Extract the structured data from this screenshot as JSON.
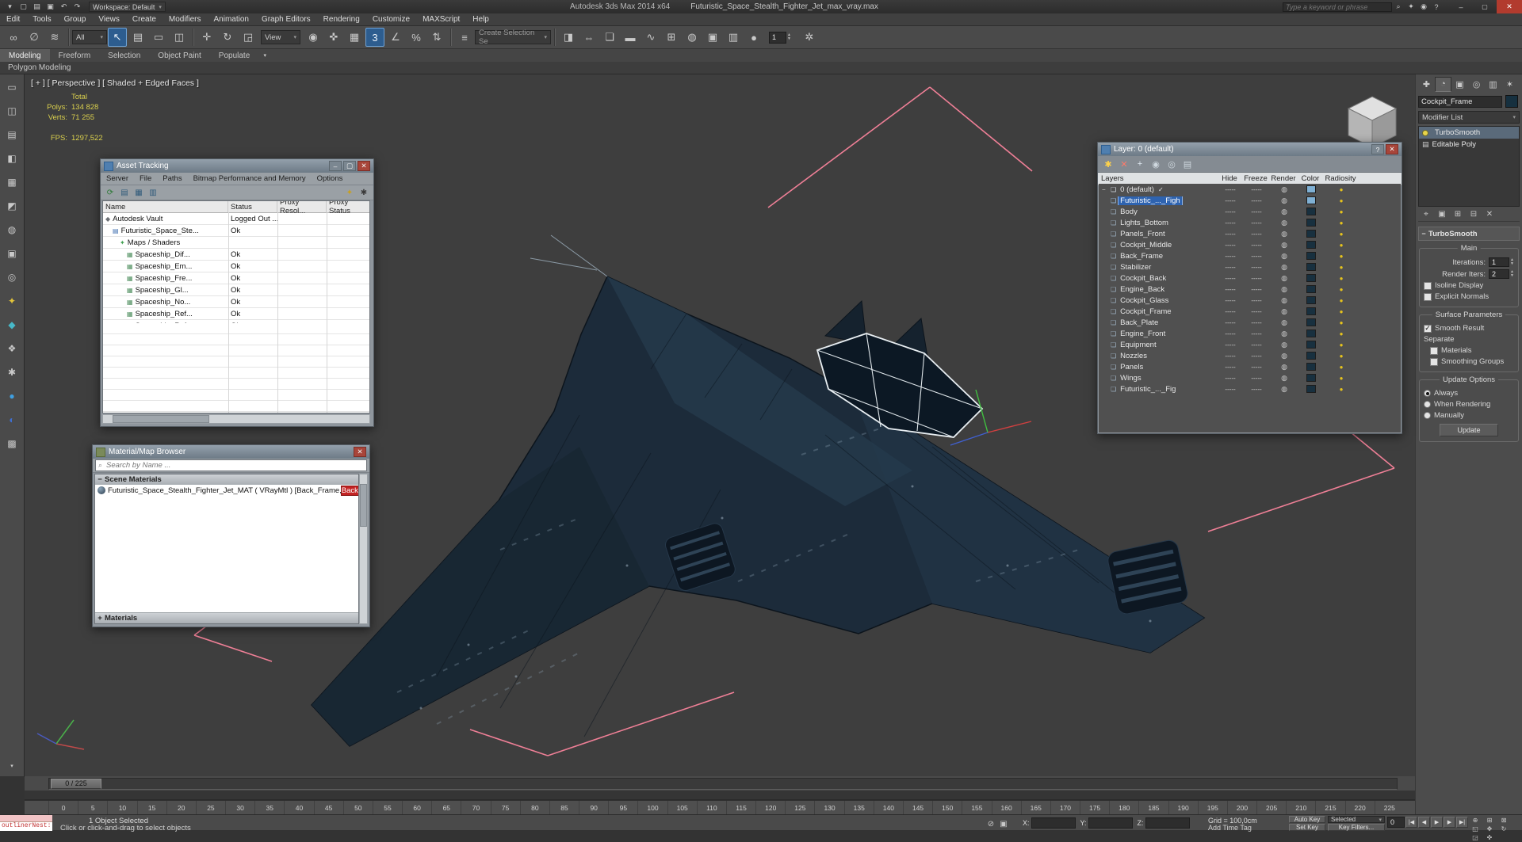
{
  "colors": {
    "accent_blue": "#2d5d8f",
    "selection_pink": "#ee7f96",
    "jet_navy": "#1c2b3a",
    "status_yellow": "#d9cf4d"
  },
  "window_controls": {
    "minimize": "–",
    "maximize": "▢",
    "close": "✕",
    "help": "?"
  },
  "titlebar": {
    "app_title": "Autodesk 3ds Max 2014 x64",
    "doc_title": "Futuristic_Space_Stealth_Fighter_Jet_max_vray.max",
    "workspace": "Workspace: Default",
    "search_placeholder": "Type a keyword or phrase",
    "quick_icons": [
      {
        "name": "app-menu-icon",
        "glyph": "▾"
      },
      {
        "name": "new-scene-icon",
        "glyph": "▢"
      },
      {
        "name": "open-file-icon",
        "glyph": "▤"
      },
      {
        "name": "save-file-icon",
        "glyph": "▣"
      },
      {
        "name": "undo-icon",
        "glyph": "↶"
      },
      {
        "name": "redo-icon",
        "glyph": "↷"
      }
    ],
    "right_icons": [
      {
        "name": "search-go-icon",
        "glyph": "⌕"
      },
      {
        "name": "infocenter-star-icon",
        "glyph": "✦"
      },
      {
        "name": "sign-in-icon",
        "glyph": "◉"
      },
      {
        "name": "help-icon",
        "glyph": "?"
      }
    ]
  },
  "menubar": {
    "items": [
      "Edit",
      "Tools",
      "Group",
      "Views",
      "Create",
      "Modifiers",
      "Animation",
      "Graph Editors",
      "Rendering",
      "Customize",
      "MAXScript",
      "Help"
    ]
  },
  "toolbar": {
    "icons_a": [
      {
        "name": "select-and-link-icon",
        "glyph": "∞"
      },
      {
        "name": "unlink-selection-icon",
        "glyph": "∅"
      },
      {
        "name": "bind-to-space-warp-icon",
        "glyph": "≋"
      }
    ],
    "filter_value": "All",
    "icons_b": [
      {
        "name": "select-object-icon",
        "glyph": "↖",
        "active": true
      },
      {
        "name": "select-by-name-icon",
        "glyph": "▤"
      },
      {
        "name": "rectangular-selection-region-icon",
        "glyph": "▭"
      },
      {
        "name": "window-crossing-icon",
        "glyph": "◫"
      }
    ],
    "icons_c": [
      {
        "name": "select-and-move-icon",
        "glyph": "✛"
      },
      {
        "name": "select-and-rotate-icon",
        "glyph": "↻"
      },
      {
        "name": "select-and-scale-icon",
        "glyph": "◲"
      }
    ],
    "view_value": "View",
    "icons_d": [
      {
        "name": "use-pivot-center-icon",
        "glyph": "◉"
      },
      {
        "name": "select-and-manipulate-icon",
        "glyph": "✜"
      },
      {
        "name": "keyboard-override-icon",
        "glyph": "▦"
      },
      {
        "name": "snaps-toggle-3d-icon",
        "glyph": "3",
        "active": true
      },
      {
        "name": "angle-snap-icon",
        "glyph": "∠"
      },
      {
        "name": "percent-snap-icon",
        "glyph": "%"
      },
      {
        "name": "spinner-snap-icon",
        "glyph": "⇅"
      }
    ],
    "icons_e": [
      {
        "name": "edit-named-selections-icon",
        "glyph": "≡"
      }
    ],
    "named_selection_value": "Create Selection Se",
    "icons_f": [
      {
        "name": "mirror-icon",
        "glyph": "◨"
      },
      {
        "name": "align-icon",
        "glyph": "⇔"
      },
      {
        "name": "layer-explorer-icon",
        "glyph": "❏"
      },
      {
        "name": "ribbon-toggle-icon",
        "glyph": "▬"
      },
      {
        "name": "curve-editor-icon",
        "glyph": "∿"
      },
      {
        "name": "schematic-view-icon",
        "glyph": "⊞"
      },
      {
        "name": "material-editor-icon",
        "glyph": "◍"
      },
      {
        "name": "render-setup-icon",
        "glyph": "▣"
      },
      {
        "name": "rendered-frame-icon",
        "glyph": "▥"
      },
      {
        "name": "render-production-icon",
        "glyph": "●"
      }
    ],
    "spinner_value": "1",
    "icons_g": [
      {
        "name": "render-gear-icon",
        "glyph": "✲"
      }
    ]
  },
  "ribbon": {
    "tabs": [
      {
        "label": "Modeling",
        "active": true
      },
      {
        "label": "Freeform"
      },
      {
        "label": "Selection"
      },
      {
        "label": "Object Paint"
      },
      {
        "label": "Populate"
      }
    ],
    "overflow_glyph": "▾",
    "subtab": "Polygon Modeling"
  },
  "left_toolbar": {
    "icons": [
      {
        "name": "left-tool-1-icon",
        "glyph": "▭"
      },
      {
        "name": "left-tool-2-icon",
        "glyph": "◫"
      },
      {
        "name": "left-tool-3-icon",
        "glyph": "▤"
      },
      {
        "name": "left-tool-4-icon",
        "glyph": "◧"
      },
      {
        "name": "left-tool-5-icon",
        "glyph": "▦"
      },
      {
        "name": "left-tool-6-icon",
        "glyph": "◩"
      },
      {
        "name": "left-tool-7-icon",
        "glyph": "◍"
      },
      {
        "name": "left-tool-8-icon",
        "glyph": "▣"
      },
      {
        "name": "left-tool-9-icon",
        "glyph": "◎"
      },
      {
        "name": "left-tool-10-icon",
        "glyph": "✦",
        "color": "#e3c43a"
      },
      {
        "name": "left-tool-11-icon",
        "glyph": "◆",
        "color": "#47b8c8"
      },
      {
        "name": "left-tool-12-icon",
        "glyph": "❖"
      },
      {
        "name": "left-tool-13-icon",
        "glyph": "✱"
      },
      {
        "name": "left-tool-14-icon",
        "glyph": "●",
        "color": "#3f9fe0"
      },
      {
        "name": "left-tool-15-icon",
        "glyph": "◐",
        "color": "#3f6fd0"
      },
      {
        "name": "left-tool-16-icon",
        "glyph": "▩"
      }
    ],
    "more_glyph": "▾"
  },
  "viewport": {
    "label": "[ + ] [ Perspective ] [ Shaded + Edged Faces ]",
    "stats": {
      "total": "Total",
      "polys_label": "Polys:",
      "polys_value": "134 828",
      "verts_label": "Verts:",
      "verts_value": "71 255",
      "fps_label": "FPS:",
      "fps_value": "1297,522"
    }
  },
  "asset_tracking": {
    "title": "Asset Tracking",
    "menu": [
      "Server",
      "File",
      "Paths",
      "Bitmap Performance and Memory",
      "Options"
    ],
    "toolbar_left": [
      {
        "name": "refresh-status-icon",
        "glyph": "⟳",
        "color": "#2f7a38"
      },
      {
        "name": "report-icon",
        "glyph": "▤",
        "color": "#2f5a7a"
      },
      {
        "name": "table-view-icon",
        "glyph": "▦",
        "color": "#2f5a7a"
      },
      {
        "name": "columns-icon",
        "glyph": "▥",
        "color": "#2f5a7a"
      }
    ],
    "toolbar_right": [
      {
        "name": "vault-login-icon",
        "glyph": "✦",
        "color": "#c8a020"
      },
      {
        "name": "vault-options-icon",
        "glyph": "✱",
        "color": "#3a3a3a"
      }
    ],
    "columns": [
      "Name",
      "Status",
      "Proxy Resol...",
      "Proxy Status"
    ],
    "rows": [
      {
        "name": "Autodesk Vault",
        "status": "Logged Out ...",
        "pad": 3,
        "icon": "◆",
        "icon_color": "#6b6f74"
      },
      {
        "name": "Futuristic_Space_Ste...",
        "status": "Ok",
        "pad": 12,
        "icon": "▤",
        "icon_color": "#3f6fb0"
      },
      {
        "name": "Maps / Shaders",
        "status": "",
        "pad": 21,
        "icon": "✦",
        "icon_color": "#3f9f4f"
      },
      {
        "name": "Spaceship_Dif...",
        "status": "Ok",
        "pad": 30,
        "icon": "▦",
        "icon_color": "#4f8f5f"
      },
      {
        "name": "Spaceship_Em...",
        "status": "Ok",
        "pad": 30,
        "icon": "▦",
        "icon_color": "#4f8f5f"
      },
      {
        "name": "Spaceship_Fre...",
        "status": "Ok",
        "pad": 30,
        "icon": "▦",
        "icon_color": "#4f8f5f"
      },
      {
        "name": "Spaceship_Gl...",
        "status": "Ok",
        "pad": 30,
        "icon": "▦",
        "icon_color": "#4f8f5f"
      },
      {
        "name": "Spaceship_No...",
        "status": "Ok",
        "pad": 30,
        "icon": "▦",
        "icon_color": "#4f8f5f"
      },
      {
        "name": "Spaceship_Ref...",
        "status": "Ok",
        "pad": 30,
        "icon": "▦",
        "icon_color": "#4f8f5f"
      },
      {
        "name": "Spaceship_Ref...",
        "status": "Ok",
        "pad": 30,
        "icon": "▦",
        "icon_color": "#4f8f5f"
      }
    ]
  },
  "material_browser": {
    "title": "Material/Map Browser",
    "search_placeholder": "Search by Name ...",
    "search_icon": "⌕",
    "collapse_glyph": "−",
    "expand_glyph": "+",
    "section": "Scene Materials",
    "item_main": "Futuristic_Space_Stealth_Fighter_Jet_MAT ( VRayMtl ) [Back_Frame, ",
    "item_highlight": "Back_Pl",
    "footer": "Materials"
  },
  "layer_explorer": {
    "title": "Layer: 0 (default)",
    "dash": "-----",
    "render_glyph": "◍",
    "radiosity_glyph": "●",
    "toolbar_icons": [
      {
        "name": "new-layer-icon",
        "glyph": "✱",
        "color": "#ffd34a"
      },
      {
        "name": "delete-layer-icon",
        "glyph": "✕",
        "color": "#ff7a6a"
      },
      {
        "name": "add-to-layer-icon",
        "glyph": "+",
        "color": "#dfe8f0"
      },
      {
        "name": "select-in-layer-icon",
        "glyph": "◉",
        "color": "#cfd8df"
      },
      {
        "name": "set-current-layer-icon",
        "glyph": "◎",
        "color": "#cfd8df"
      },
      {
        "name": "hide-freeze-icon",
        "glyph": "▤",
        "color": "#cfd8df"
      }
    ],
    "columns": [
      "Layers",
      "Hide",
      "Freeze",
      "Render",
      "Color",
      "Radiosity"
    ],
    "rows": [
      {
        "name": "0 (default)",
        "expand": "−",
        "icon": "❏",
        "icon_color": "#d5dde3",
        "check": "✓",
        "color": "#7fb0d4"
      },
      {
        "name": "Futuristic_..._Figh",
        "icon": "❏",
        "icon_color": "#9fc4e8",
        "selected": true,
        "color": "#7fb0d4"
      },
      {
        "name": "Body",
        "icon": "❏",
        "icon_color": "#9fb4c4",
        "color": "#18303f"
      },
      {
        "name": "Lights_Bottom",
        "icon": "❏",
        "icon_color": "#9fb4c4",
        "color": "#18303f"
      },
      {
        "name": "Panels_Front",
        "icon": "❏",
        "icon_color": "#9fb4c4",
        "color": "#18303f"
      },
      {
        "name": "Cockpit_Middle",
        "icon": "❏",
        "icon_color": "#9fb4c4",
        "color": "#18303f"
      },
      {
        "name": "Back_Frame",
        "icon": "❏",
        "icon_color": "#9fb4c4",
        "color": "#18303f"
      },
      {
        "name": "Stabilizer",
        "icon": "❏",
        "icon_color": "#9fb4c4",
        "color": "#18303f"
      },
      {
        "name": "Cockpit_Back",
        "icon": "❏",
        "icon_color": "#9fb4c4",
        "color": "#18303f"
      },
      {
        "name": "Engine_Back",
        "icon": "❏",
        "icon_color": "#9fb4c4",
        "color": "#18303f"
      },
      {
        "name": "Cockpit_Glass",
        "icon": "❏",
        "icon_color": "#9fb4c4",
        "color": "#18303f"
      },
      {
        "name": "Cockpit_Frame",
        "icon": "❏",
        "icon_color": "#9fb4c4",
        "color": "#18303f"
      },
      {
        "name": "Back_Plate",
        "icon": "❏",
        "icon_color": "#9fb4c4",
        "color": "#18303f"
      },
      {
        "name": "Engine_Front",
        "icon": "❏",
        "icon_color": "#9fb4c4",
        "color": "#18303f"
      },
      {
        "name": "Equipment",
        "icon": "❏",
        "icon_color": "#9fb4c4",
        "color": "#18303f"
      },
      {
        "name": "Nozzles",
        "icon": "❏",
        "icon_color": "#9fb4c4",
        "color": "#18303f"
      },
      {
        "name": "Panels",
        "icon": "❏",
        "icon_color": "#9fb4c4",
        "color": "#18303f"
      },
      {
        "name": "Wings",
        "icon": "❏",
        "icon_color": "#9fb4c4",
        "color": "#18303f"
      },
      {
        "name": "Futuristic_..._Fig",
        "icon": "❏",
        "icon_color": "#9fb4c4",
        "color": "#18303f"
      }
    ]
  },
  "command_panel": {
    "tabs": [
      {
        "name": "create-tab",
        "glyph": "✚"
      },
      {
        "name": "modify-tab",
        "glyph": "◔",
        "active": true
      },
      {
        "name": "hierarchy-tab",
        "glyph": "▣"
      },
      {
        "name": "motion-tab",
        "glyph": "◎"
      },
      {
        "name": "display-tab",
        "glyph": "▥"
      },
      {
        "name": "utilities-tab",
        "glyph": "✶"
      }
    ],
    "object_name": "Cockpit_Frame",
    "modifier_list_label": "Modifier List",
    "stack": [
      {
        "label": "TurboSmooth",
        "bulb": true,
        "italic": true,
        "selected": true
      },
      {
        "label": "Editable Poly",
        "glyph": "▤"
      }
    ],
    "stack_icons": [
      {
        "name": "pin-stack-icon",
        "glyph": "⌖"
      },
      {
        "name": "show-end-result-icon",
        "glyph": "▣"
      },
      {
        "name": "make-unique-icon",
        "glyph": "⊞"
      },
      {
        "name": "remove-modifier-icon",
        "glyph": "⊟"
      },
      {
        "name": "configure-modifier-sets-icon",
        "glyph": "✕"
      }
    ],
    "rollout": {
      "title": "TurboSmooth",
      "collapse_glyph": "−",
      "group_main": "Main",
      "iterations_label": "Iterations:",
      "iterations_value": "1",
      "render_iters_label": "Render Iters:",
      "render_iters_value": "2",
      "isoline_label": "Isoline Display",
      "explicit_label": "Explicit Normals",
      "group_surface": "Surface Parameters",
      "smooth_result_label": "Smooth Result",
      "separate_label": "Separate",
      "materials_label": "Materials",
      "smoothing_groups_label": "Smoothing Groups",
      "group_update": "Update Options",
      "radio_always": "Always",
      "radio_when_rendering": "When Rendering",
      "radio_manually": "Manually",
      "update_button": "Update"
    }
  },
  "timeline": {
    "handle_label": "0 / 225",
    "ticks": [
      "0",
      "5",
      "10",
      "15",
      "20",
      "25",
      "30",
      "35",
      "40",
      "45",
      "50",
      "55",
      "60",
      "65",
      "70",
      "75",
      "80",
      "85",
      "90",
      "95",
      "100",
      "105",
      "110",
      "115",
      "120",
      "125",
      "130",
      "135",
      "140",
      "145",
      "150",
      "155",
      "160",
      "165",
      "170",
      "175",
      "180",
      "185",
      "190",
      "195",
      "200",
      "205",
      "210",
      "215",
      "220",
      "225"
    ]
  },
  "statusbar": {
    "listener_text": "outlinerNest:",
    "selection_status": "1 Object Selected",
    "prompt": "Click or click-and-drag to select objects",
    "mini_icons": [
      {
        "name": "isolate-selection-icon",
        "glyph": "⊘"
      },
      {
        "name": "selection-lock-toggle-icon",
        "glyph": "▣"
      }
    ],
    "x_label": "X:",
    "y_label": "Y:",
    "z_label": "Z:",
    "grid_label": "Grid = 100,0cm",
    "add_time_tag": "Add Time Tag",
    "auto_key": "Auto Key",
    "set_key": "Set Key",
    "selected_dropdown": "Selected",
    "key_filters": "Key Filters...",
    "frame_value": "0",
    "transport": [
      {
        "name": "go-to-start-button",
        "glyph": "|◀"
      },
      {
        "name": "previous-frame-button",
        "glyph": "◀"
      },
      {
        "name": "play-animation-button",
        "glyph": "▶"
      },
      {
        "name": "next-frame-button",
        "glyph": "▶"
      },
      {
        "name": "go-to-end-button",
        "glyph": "▶|"
      }
    ],
    "nav_icons": [
      {
        "name": "zoom-icon",
        "glyph": "⊕"
      },
      {
        "name": "zoom-all-icon",
        "glyph": "⊞"
      },
      {
        "name": "zoom-extents-icon",
        "glyph": "⊠"
      },
      {
        "name": "field-of-view-icon",
        "glyph": "◱"
      },
      {
        "name": "pan-icon",
        "glyph": "✥"
      },
      {
        "name": "orbit-icon",
        "glyph": "↻"
      },
      {
        "name": "maximize-viewport-toggle-icon",
        "glyph": "◲"
      },
      {
        "name": "walkthrough-icon",
        "glyph": "✜"
      }
    ]
  }
}
